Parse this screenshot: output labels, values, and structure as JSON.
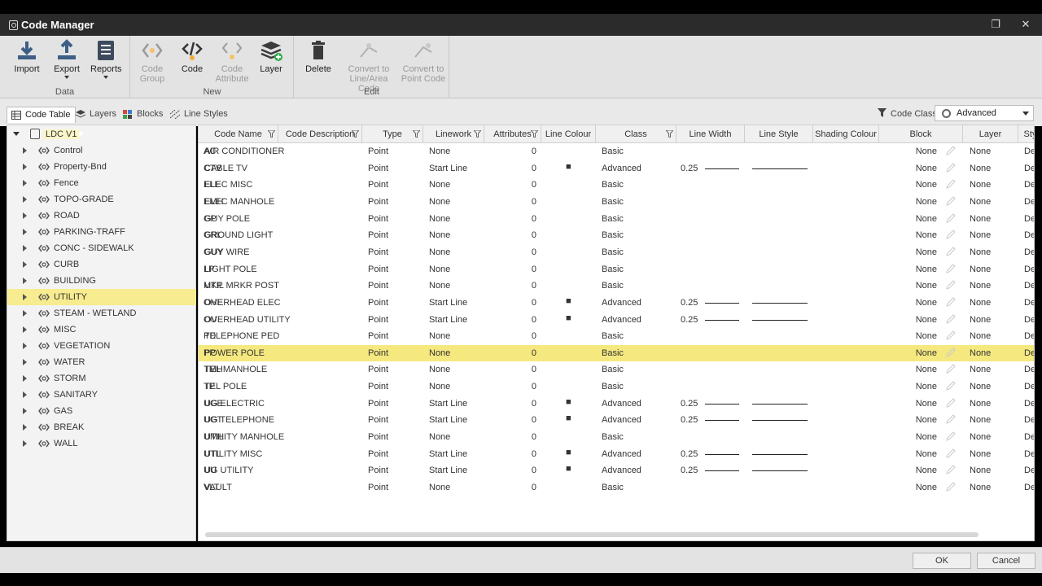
{
  "window": {
    "title": "Code Manager"
  },
  "ribbon": {
    "data_group": "Data",
    "new_group": "New",
    "edit_group": "Edit",
    "import": "Import",
    "export": "Export",
    "reports": "Reports",
    "code_group": "Code Group",
    "code": "Code",
    "code_attribute": "Code Attribute",
    "layer": "Layer",
    "delete": "Delete",
    "convert_line": "Convert to Line/Area Code",
    "convert_point": "Convert to Point Code"
  },
  "tabs": [
    "Code Table",
    "Layers",
    "Blocks",
    "Line Styles"
  ],
  "code_class": {
    "label": "Code Class",
    "value": "Advanced"
  },
  "tree": {
    "root": "LDC V1",
    "items": [
      "Control",
      "Property-Bnd",
      "Fence",
      "TOPO-GRADE",
      "ROAD",
      "PARKING-TRAFF",
      "CONC - SIDEWALK",
      "CURB",
      "BUILDING",
      "UTILITY",
      "STEAM - WETLAND",
      "MISC",
      "VEGETATION",
      "WATER",
      "STORM",
      "SANITARY",
      "GAS",
      "BREAK",
      "WALL"
    ],
    "selected": "UTILITY"
  },
  "grid": {
    "headers": [
      "Code Name",
      "Code Description",
      "Type",
      "Linework",
      "Attributes",
      "Line Colour",
      "Class",
      "Line Width",
      "Line Style",
      "Shading Colour",
      "Block",
      "Layer",
      "Sty"
    ],
    "rows": [
      [
        "AC",
        "AIR CONDITIONER",
        "Point",
        "None",
        "0",
        "",
        "Basic",
        "",
        "",
        "",
        "None",
        "None",
        "De"
      ],
      [
        "CTV",
        "CABLE TV",
        "Point",
        "Start Line",
        "0",
        "■",
        "Advanced",
        "0.25",
        "",
        "",
        "None",
        "None",
        "De"
      ],
      [
        "ELE",
        "ELEC MISC",
        "Point",
        "None",
        "0",
        "",
        "Basic",
        "",
        "",
        "",
        "None",
        "None",
        "De"
      ],
      [
        "EMH",
        "ELEC MANHOLE",
        "Point",
        "None",
        "0",
        "",
        "Basic",
        "",
        "",
        "",
        "None",
        "None",
        "De"
      ],
      [
        "GP",
        "GUY POLE",
        "Point",
        "None",
        "0",
        "",
        "Basic",
        "",
        "",
        "",
        "None",
        "None",
        "De"
      ],
      [
        "GRL",
        "GROUND LIGHT",
        "Point",
        "None",
        "0",
        "",
        "Basic",
        "",
        "",
        "",
        "None",
        "None",
        "De"
      ],
      [
        "GUY",
        "GUY WIRE",
        "Point",
        "None",
        "0",
        "",
        "Basic",
        "",
        "",
        "",
        "None",
        "None",
        "De"
      ],
      [
        "LP",
        "LIGHT POLE",
        "Point",
        "None",
        "0",
        "",
        "Basic",
        "",
        "",
        "",
        "None",
        "None",
        "De"
      ],
      [
        "MKP",
        "UTIL MRKR POST",
        "Point",
        "None",
        "0",
        "",
        "Basic",
        "",
        "",
        "",
        "None",
        "None",
        "De"
      ],
      [
        "OHE",
        "OVERHEAD ELEC",
        "Point",
        "Start Line",
        "0",
        "■",
        "Advanced",
        "0.25",
        "",
        "",
        "None",
        "None",
        "De"
      ],
      [
        "OU",
        "OVERHEAD UTILITY",
        "Point",
        "Start Line",
        "0",
        "■",
        "Advanced",
        "0.25",
        "",
        "",
        "None",
        "None",
        "De"
      ],
      [
        "PD",
        "TELEPHONE PED",
        "Point",
        "None",
        "0",
        "",
        "Basic",
        "",
        "",
        "",
        "None",
        "None",
        "De"
      ],
      [
        "PP",
        "POWER POLE",
        "Point",
        "None",
        "0",
        "",
        "Basic",
        "",
        "",
        "",
        "None",
        "None",
        "De"
      ],
      [
        "TMH",
        "TEL MANHOLE",
        "Point",
        "None",
        "0",
        "",
        "Basic",
        "",
        "",
        "",
        "None",
        "None",
        "De"
      ],
      [
        "TP",
        "TEL POLE",
        "Point",
        "None",
        "0",
        "",
        "Basic",
        "",
        "",
        "",
        "None",
        "None",
        "De"
      ],
      [
        "UGE",
        "UG ELECTRIC",
        "Point",
        "Start Line",
        "0",
        "■",
        "Advanced",
        "0.25",
        "",
        "",
        "None",
        "None",
        "De"
      ],
      [
        "UGT",
        "UG TELEPHONE",
        "Point",
        "Start Line",
        "0",
        "■",
        "Advanced",
        "0.25",
        "",
        "",
        "None",
        "None",
        "De"
      ],
      [
        "UMH",
        "UTILITY MANHOLE",
        "Point",
        "None",
        "0",
        "",
        "Basic",
        "",
        "",
        "",
        "None",
        "None",
        "De"
      ],
      [
        "UTL",
        "UTILITY MISC",
        "Point",
        "Start Line",
        "0",
        "■",
        "Advanced",
        "0.25",
        "",
        "",
        "None",
        "None",
        "De"
      ],
      [
        "UU",
        "UG UTILITY",
        "Point",
        "Start Line",
        "0",
        "■",
        "Advanced",
        "0.25",
        "",
        "",
        "None",
        "None",
        "De"
      ],
      [
        "VLT",
        "VAULT",
        "Point",
        "None",
        "0",
        "",
        "Basic",
        "",
        "",
        "",
        "None",
        "None",
        "De"
      ]
    ],
    "selected_row": 12
  },
  "footer": {
    "ok": "OK",
    "cancel": "Cancel"
  }
}
